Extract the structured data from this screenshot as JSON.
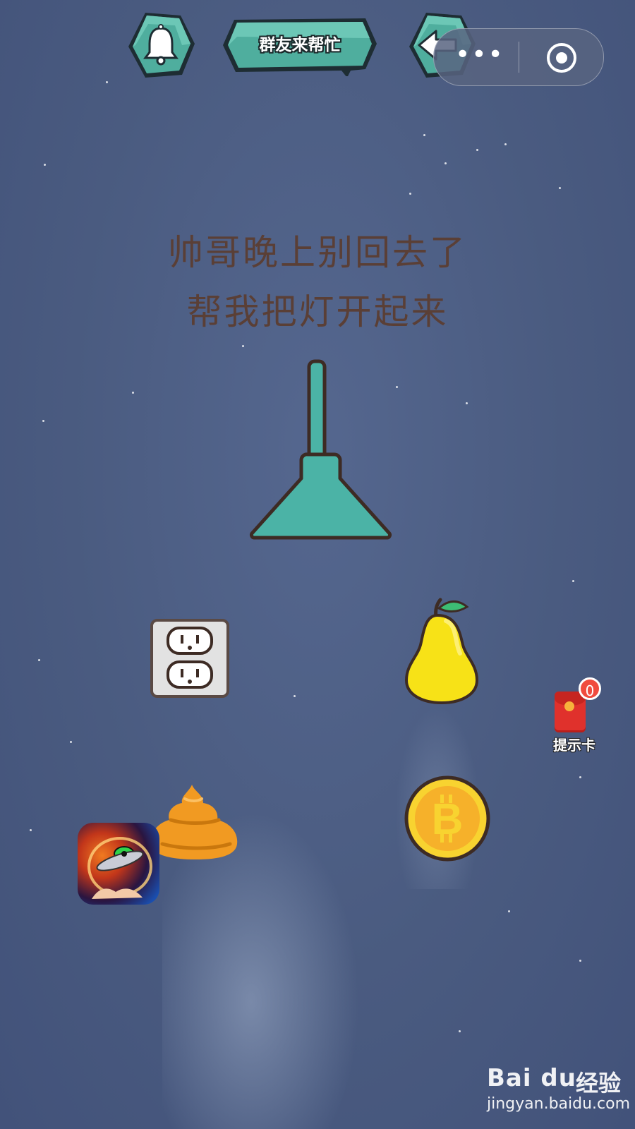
{
  "header": {
    "bell_icon": "bell-icon",
    "title": "群友来帮忙",
    "back_icon": "back-arrow-icon",
    "capsule": {
      "more_icon": "more-dots-icon",
      "more_text": "•••",
      "close_icon": "target-close-icon"
    }
  },
  "puzzle": {
    "line1": "帅哥晚上别回去了",
    "line2": "帮我把灯开起来"
  },
  "items": [
    "lamp",
    "power-outlet",
    "pear",
    "poop",
    "bitcoin-coin"
  ],
  "hint_card": {
    "label": "提示卡",
    "count": "0"
  },
  "watermark": {
    "brand": "Bai du",
    "cn": "经验",
    "url": "jingyan.baidu.com"
  },
  "colors": {
    "teal": "#4bb3a6",
    "text": "#5a3f36",
    "bg": "#4a5b80"
  }
}
